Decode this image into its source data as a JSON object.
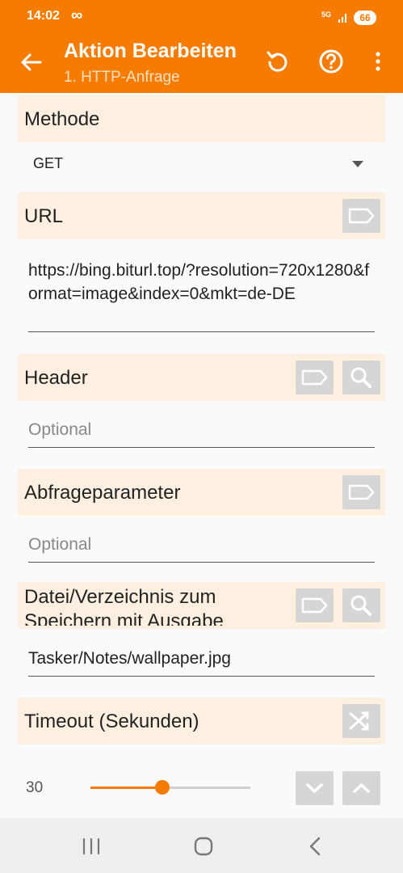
{
  "status_bar": {
    "time": "14:02",
    "extra_icon": "∞",
    "network": "5G",
    "battery": "66"
  },
  "app_bar": {
    "title": "Aktion Bearbeiten",
    "subtitle": "1. HTTP-Anfrage",
    "icons": [
      "back-arrow-icon",
      "undo-icon",
      "help-icon",
      "more-vert-icon"
    ]
  },
  "sections": {
    "method": {
      "label": "Methode",
      "value": "GET"
    },
    "url": {
      "label": "URL",
      "value": "https://bing.biturl.top/?resolution=720x1280&format=image&index=0&mkt=de-DE"
    },
    "header": {
      "label": "Header",
      "placeholder": "Optional"
    },
    "query": {
      "label": "Abfrageparameter",
      "placeholder": "Optional"
    },
    "file": {
      "label": "Datei/Verzeichnis zum Speichern mit Ausgabe",
      "value": "Tasker/Notes/wallpaper.jpg"
    },
    "timeout": {
      "label": "Timeout (Sekunden)",
      "value": "30",
      "slider_fraction": 0.45
    }
  },
  "colors": {
    "accent": "#f57c00",
    "section_bg": "#fdf0e0",
    "button_bg": "#d6d6d6"
  }
}
